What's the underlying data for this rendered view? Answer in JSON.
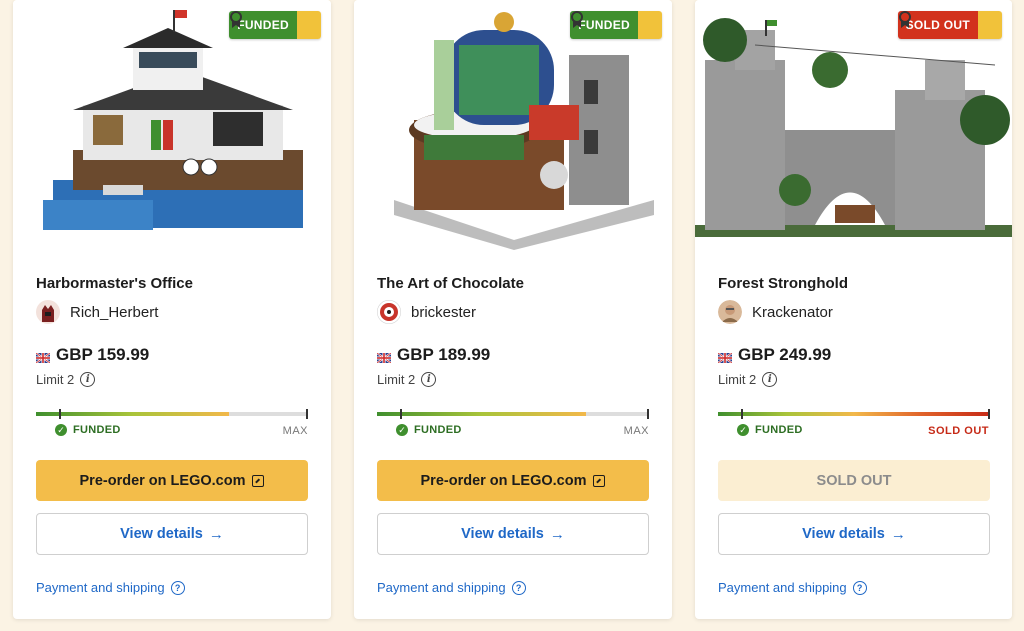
{
  "cards": [
    {
      "title": "Harbormaster's Office",
      "creator": "Rich_Herbert",
      "price": "GBP 159.99",
      "limit": "Limit 2",
      "badge": "FUNDED",
      "status_left": "FUNDED",
      "status_right": "MAX",
      "progress": 0.71,
      "primary_button": "Pre-order on LEGO.com",
      "details_button": "View details",
      "payment_link": "Payment and shipping"
    },
    {
      "title": "The Art of Chocolate",
      "creator": "brickester",
      "price": "GBP 189.99",
      "limit": "Limit 2",
      "badge": "FUNDED",
      "status_left": "FUNDED",
      "status_right": "MAX",
      "progress": 0.77,
      "primary_button": "Pre-order on LEGO.com",
      "details_button": "View details",
      "payment_link": "Payment and shipping"
    },
    {
      "title": "Forest Stronghold",
      "creator": "Krackenator",
      "price": "GBP 249.99",
      "limit": "Limit 2",
      "badge": "SOLD OUT",
      "status_left": "FUNDED",
      "status_right": "SOLD OUT",
      "progress": 1.0,
      "primary_button": "SOLD OUT",
      "details_button": "View details",
      "payment_link": "Payment and shipping"
    }
  ],
  "colors": {
    "background": "#fbf3e4",
    "funded_green": "#3f8f2e",
    "sold_red": "#d2321d",
    "button_yellow": "#f3bd4a",
    "link_blue": "#1f68c7"
  }
}
